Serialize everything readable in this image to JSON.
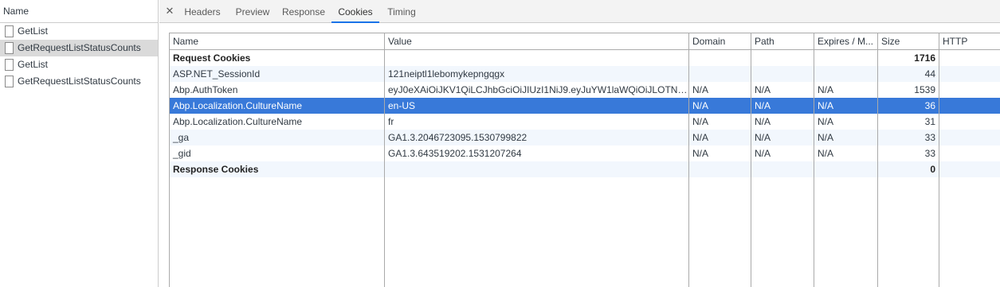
{
  "left_panel": {
    "header": "Name",
    "requests": [
      {
        "label": "GetList",
        "selected": false
      },
      {
        "label": "GetRequestListStatusCounts",
        "selected": true
      },
      {
        "label": "GetList",
        "selected": false
      },
      {
        "label": "GetRequestListStatusCounts",
        "selected": false
      }
    ]
  },
  "tabs": {
    "headers": "Headers",
    "preview": "Preview",
    "response": "Response",
    "cookies": "Cookies",
    "timing": "Timing",
    "active": "Cookies"
  },
  "close_icon": "close-icon",
  "table": {
    "columns": {
      "name": "Name",
      "value": "Value",
      "domain": "Domain",
      "path": "Path",
      "expires": "Expires / M...",
      "size": "Size",
      "http": "HTTP"
    },
    "rows": [
      {
        "name": "Request Cookies",
        "value": "",
        "domain": "",
        "path": "",
        "expires": "",
        "size": "1716",
        "http": "",
        "group": true
      },
      {
        "name": "ASP.NET_SessionId",
        "value": "121neiptl1lebomykepngqgx",
        "domain": "",
        "path": "",
        "expires": "",
        "size": "44",
        "http": ""
      },
      {
        "name": "Abp.AuthToken",
        "value": "eyJ0eXAiOiJKV1QiLCJhbGciOiJIUzI1NiJ9.eyJuYW1laWQiOiJLOTNmdG...",
        "domain": "N/A",
        "path": "N/A",
        "expires": "N/A",
        "size": "1539",
        "http": ""
      },
      {
        "name": "Abp.Localization.CultureName",
        "value": "en-US",
        "domain": "N/A",
        "path": "N/A",
        "expires": "N/A",
        "size": "36",
        "http": "",
        "selected": true
      },
      {
        "name": "Abp.Localization.CultureName",
        "value": "fr",
        "domain": "N/A",
        "path": "N/A",
        "expires": "N/A",
        "size": "31",
        "http": ""
      },
      {
        "name": "_ga",
        "value": "GA1.3.2046723095.1530799822",
        "domain": "N/A",
        "path": "N/A",
        "expires": "N/A",
        "size": "33",
        "http": ""
      },
      {
        "name": "_gid",
        "value": "GA1.3.643519202.1531207264",
        "domain": "N/A",
        "path": "N/A",
        "expires": "N/A",
        "size": "33",
        "http": ""
      },
      {
        "name": "Response Cookies",
        "value": "",
        "domain": "",
        "path": "",
        "expires": "",
        "size": "0",
        "http": "",
        "group": true
      }
    ]
  },
  "colors": {
    "selected_row": "#3879d9",
    "alt_row": "#f2f7fd",
    "active_tab_underline": "#1a73e8",
    "selected_request": "#dadada"
  }
}
